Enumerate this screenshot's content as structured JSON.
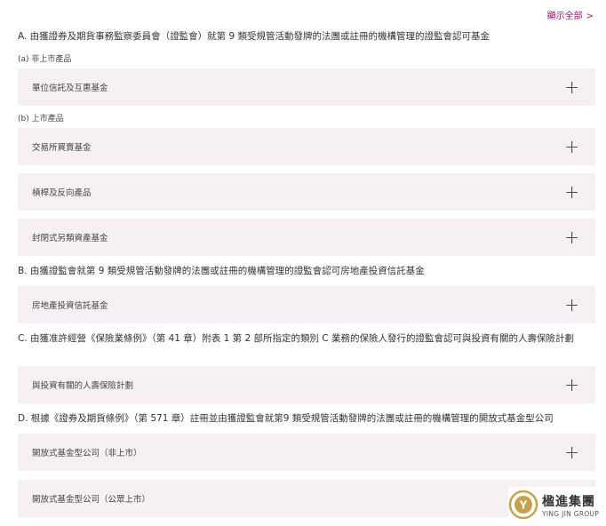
{
  "header": {
    "show_all_label": "顯示全部",
    "show_all_chevron": ">"
  },
  "sections": {
    "a": {
      "title": "A. 由獲證券及期貨事務監察委員會（證監會）就第 9 類受規管活動發牌的法團或註冊的機構管理的證監會認可基金",
      "sub_unlisted": "(a) 非上市產品",
      "unit_trusts": "單位信託及互惠基金",
      "sub_listed": "(b) 上市產品",
      "etf": "交易所買賣基金",
      "leveraged": "槓桿及反向產品",
      "closed_end": "封閉式另類資產基金"
    },
    "b": {
      "title": "B. 由獲證監會就第 9 類受規管活動發牌的法團或註冊的機構管理的證監會認可房地產投資信託基金",
      "reit": "房地產投資信託基金"
    },
    "c": {
      "title": "C. 由獲准許經營《保險業條例》（第 41 章）附表 1 第 2 部所指定的類別 C 業務的保險人發行的證監會認可與投資有關的人壽保險計劃",
      "ilas": "與投資有關的人壽保險計劃"
    },
    "d": {
      "title": "D. 根據《證券及期貨條例》（第 571 章）註冊並由獲證監會就第9 類受規管活動發牌的法團或註冊的機構管理的開放式基金型公司",
      "ofc_unlisted": "開放式基金型公司（非上市）",
      "ofc_listed": "開放式基金型公司（公眾上市）"
    }
  },
  "expand_symbol": "+",
  "logo": {
    "name_zh": "楹進集團",
    "name_en": "YING JIN GROUP",
    "mark_letter": "Y"
  },
  "colors": {
    "accent": "#8a1f6b",
    "row_bg": "#f6eff4",
    "logo_gold": "#c8a24a"
  }
}
